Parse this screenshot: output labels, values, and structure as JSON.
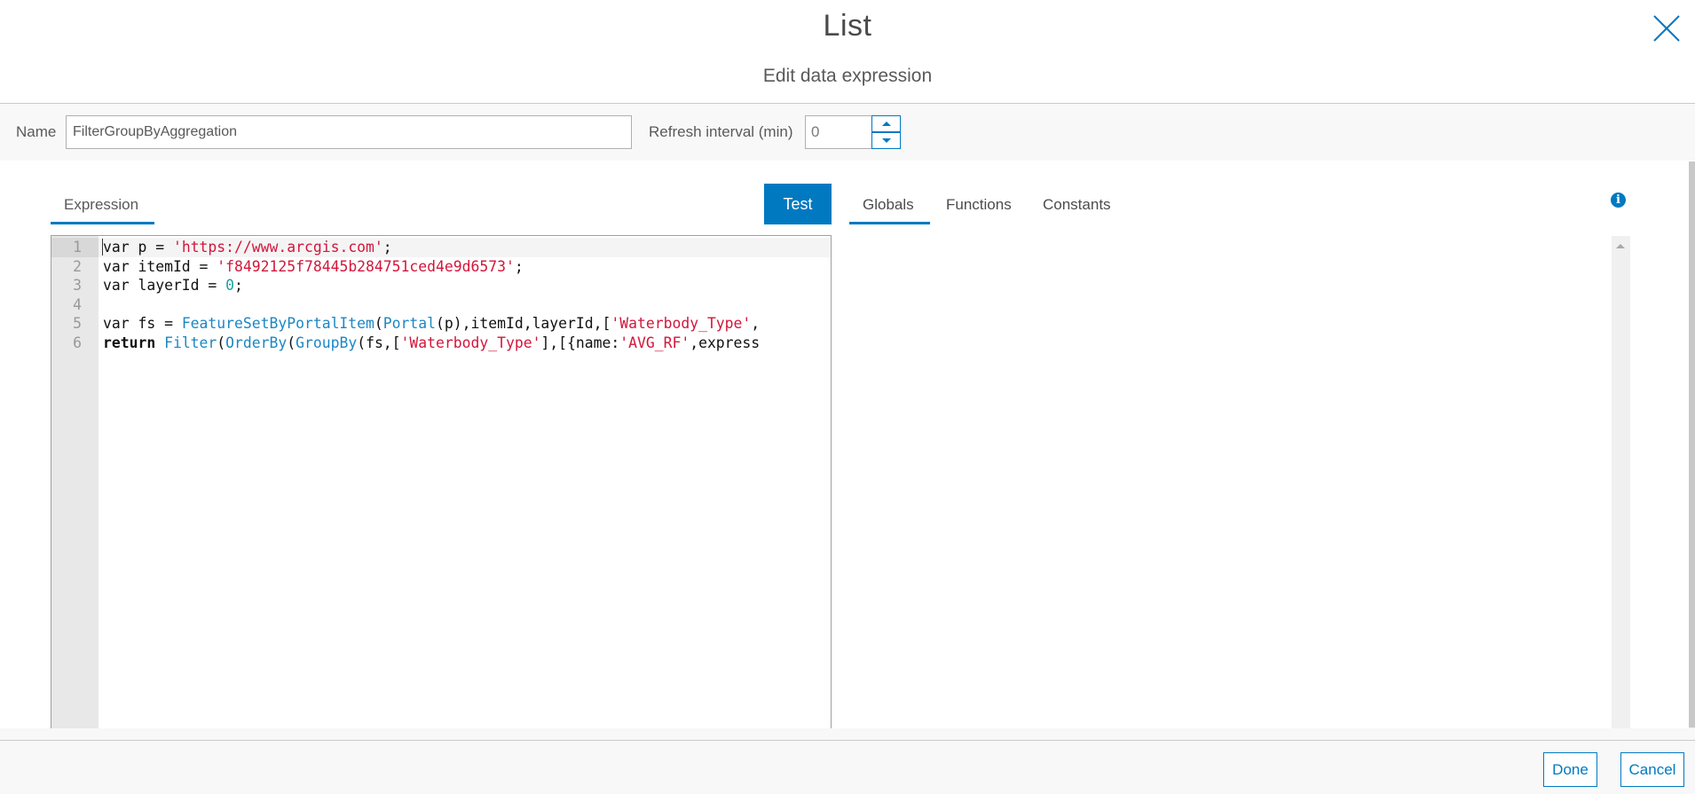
{
  "header": {
    "title": "List",
    "subtitle": "Edit data expression",
    "close_icon": "close-x-icon"
  },
  "settings": {
    "name_label": "Name",
    "name_value": "FilterGroupByAggregation",
    "refresh_label": "Refresh interval (min)",
    "refresh_value": "0",
    "spinner_up_icon": "caret-up-icon",
    "spinner_down_icon": "caret-down-icon"
  },
  "left_tabs": [
    {
      "label": "Expression",
      "active": true
    }
  ],
  "test_button": "Test",
  "right_tabs": [
    {
      "label": "Globals",
      "active": true
    },
    {
      "label": "Functions",
      "active": false
    },
    {
      "label": "Constants",
      "active": false
    }
  ],
  "info_icon": "info-icon",
  "editor": {
    "active_line": 1,
    "lines": [
      {
        "num": "1",
        "tokens": [
          [
            "kw",
            "var p = "
          ],
          [
            "str",
            "'https://www.arcgis.com'"
          ],
          [
            "kw",
            ";"
          ]
        ]
      },
      {
        "num": "2",
        "tokens": [
          [
            "kw",
            "var itemId = "
          ],
          [
            "str",
            "'f8492125f78445b284751ced4e9d6573'"
          ],
          [
            "kw",
            ";"
          ]
        ]
      },
      {
        "num": "3",
        "tokens": [
          [
            "kw",
            "var layerId = "
          ],
          [
            "num",
            "0"
          ],
          [
            "kw",
            ";"
          ]
        ]
      },
      {
        "num": "4",
        "tokens": []
      },
      {
        "num": "5",
        "tokens": [
          [
            "kw",
            "var fs = "
          ],
          [
            "fn",
            "FeatureSetByPortalItem"
          ],
          [
            "kw",
            "("
          ],
          [
            "fn",
            "Portal"
          ],
          [
            "kw",
            "(p),itemId,layerId,["
          ],
          [
            "str",
            "'Waterbody_Type'"
          ],
          [
            "kw",
            ","
          ]
        ]
      },
      {
        "num": "6",
        "tokens": [
          [
            "kw-b",
            "return "
          ],
          [
            "fn",
            "Filter"
          ],
          [
            "kw",
            "("
          ],
          [
            "fn",
            "OrderBy"
          ],
          [
            "kw",
            "("
          ],
          [
            "fn",
            "GroupBy"
          ],
          [
            "kw",
            "(fs,["
          ],
          [
            "str",
            "'Waterbody_Type'"
          ],
          [
            "kw",
            "],[{name:"
          ],
          [
            "str",
            "'AVG_RF'"
          ],
          [
            "kw",
            ",express"
          ]
        ]
      }
    ]
  },
  "footer": {
    "done_label": "Done",
    "cancel_label": "Cancel"
  },
  "colors": {
    "accent": "#0079c1",
    "string": "#d2163b",
    "function": "#1b87c4",
    "number": "#1aa0a4"
  }
}
